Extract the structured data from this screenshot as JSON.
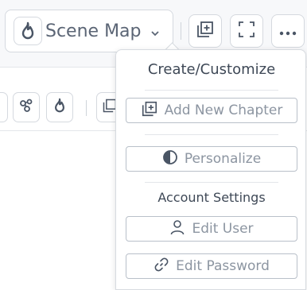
{
  "toolbar": {
    "scene_label": "Scene Map"
  },
  "menu": {
    "create_title": "Create/Customize",
    "add_chapter": "Add New Chapter",
    "personalize": "Personalize",
    "account_title": "Account Settings",
    "edit_user": "Edit User",
    "edit_password": "Edit Password"
  },
  "icons": {
    "scene": "flame-icon",
    "add": "add-layer-icon",
    "fullscreen": "fullscreen-icon",
    "more": "more-icon",
    "network": "network-icon",
    "drop": "flame-icon",
    "contrast": "contrast-icon",
    "user": "user-icon",
    "link": "link-icon"
  },
  "colors": {
    "accent": "#4a5565",
    "muted_text": "#8c95a1",
    "border": "#b9c0c9"
  }
}
